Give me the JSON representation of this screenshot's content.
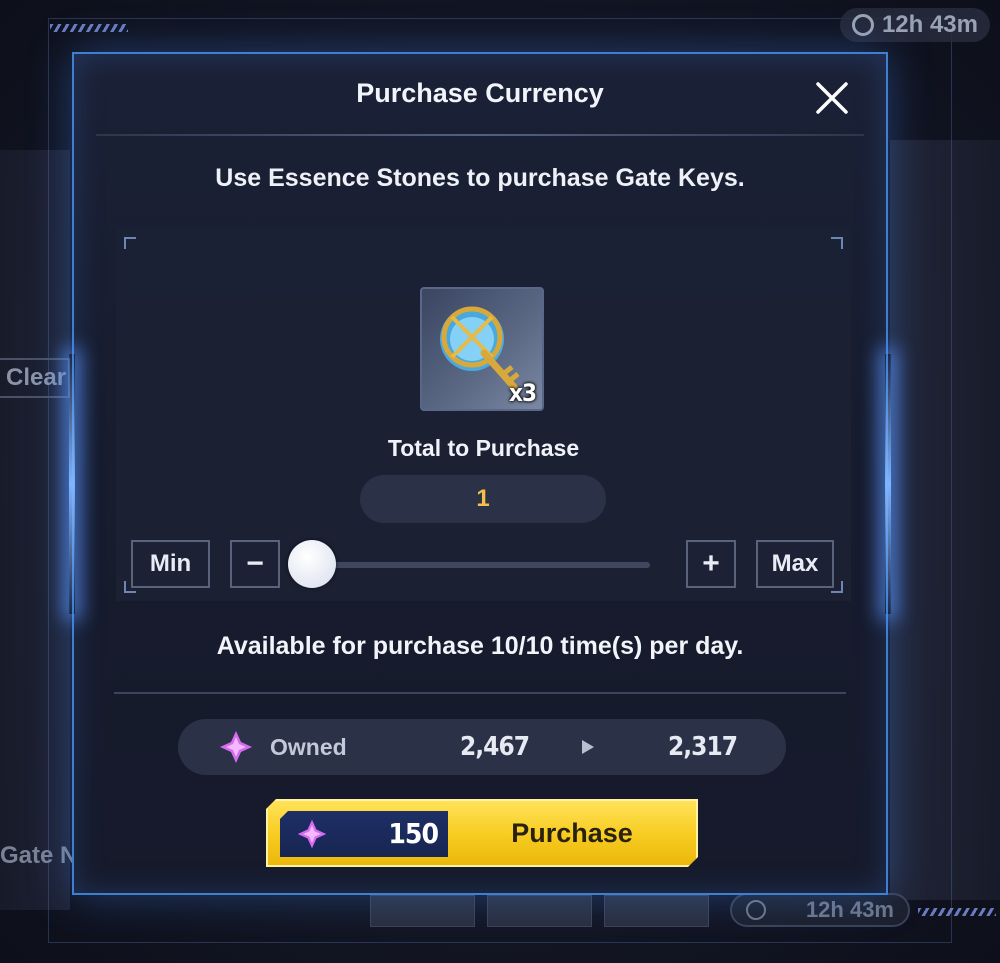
{
  "background": {
    "top_timer": "12h 43m",
    "bottom_timer": "12h 43m",
    "left_button": "Clear",
    "left_label": "Gate N"
  },
  "dialog": {
    "title": "Purchase Currency",
    "subtitle": "Use Essence Stones to purchase Gate Keys.",
    "item": {
      "icon": "gate-key-icon",
      "quantity_badge": "x3"
    },
    "total_label": "Total to Purchase",
    "total_value": "1",
    "controls": {
      "min_label": "Min",
      "minus_label": "−",
      "plus_label": "+",
      "max_label": "Max",
      "slider_fraction": 0.0
    },
    "limit_text": "Available for purchase 10/10 time(s) per day.",
    "owned": {
      "label": "Owned",
      "current": "2,467",
      "after": "2,317",
      "icon": "essence-stone-icon"
    },
    "purchase": {
      "cost": "150",
      "label": "Purchase"
    }
  },
  "colors": {
    "accent_border": "#3d7fd0",
    "total_value": "#f4c04a",
    "purchase_button": "#f7cb1f",
    "gem": "#d56cf0"
  }
}
